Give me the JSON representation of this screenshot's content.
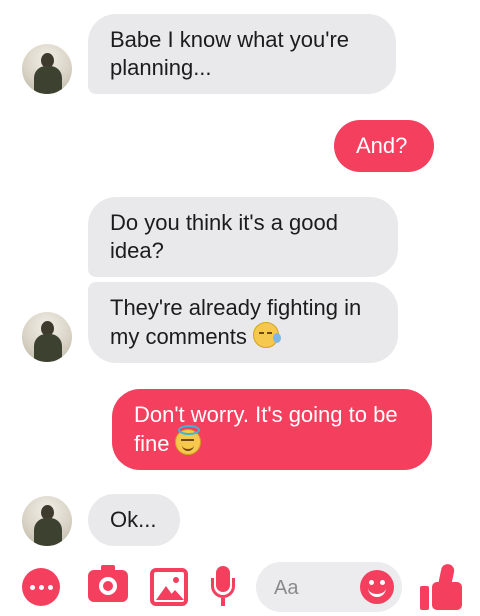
{
  "messages": [
    {
      "side": "in",
      "text": "Babe I know what you're planning..."
    },
    {
      "side": "out",
      "text": "And?"
    },
    {
      "side": "in",
      "text": "Do you think it's a good idea?"
    },
    {
      "side": "in",
      "text": "They're already fighting in my comments",
      "emoji": "sleepy-face"
    },
    {
      "side": "out",
      "text": "Don't worry. It's going to be fine",
      "emoji": "smiling-face-with-halo"
    },
    {
      "side": "in",
      "text": "Ok..."
    }
  ],
  "composer": {
    "placeholder": "Aa",
    "icons": [
      "more-icon",
      "camera-icon",
      "gallery-icon",
      "microphone-icon",
      "emoji-icon",
      "thumbs-up-icon"
    ],
    "accent": "#f43f5e"
  },
  "colors": {
    "incoming_bubble": "#e9e9eb",
    "outgoing_bubble": "#f43f5e"
  }
}
